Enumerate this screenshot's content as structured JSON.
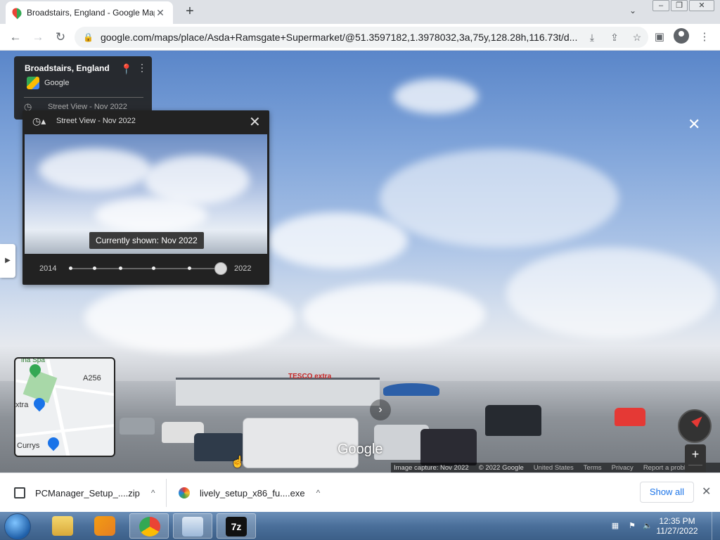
{
  "browser": {
    "tab_title": "Broadstairs, England - Google Maps",
    "tab_close": "✕",
    "new_tab": "+",
    "url": "google.com/maps/place/Asda+Ramsgate+Supermarket/@51.3597182,1.3978032,3a,75y,128.28h,116.73t/d..."
  },
  "place_card": {
    "name": "Broadstairs, England",
    "brand": "Google",
    "street_view_label": "Street View - Nov 2022"
  },
  "time_panel": {
    "header": "Street View - Nov 2022",
    "currently_shown": "Currently shown: Nov 2022",
    "year_start": "2014",
    "year_end": "2022",
    "slider_position_fraction": 1.0
  },
  "map": {
    "minimap_labels": [
      "ina Spa",
      "A256",
      "xtra",
      "Currys"
    ],
    "watermark": "Google",
    "footer": {
      "image_capture": "Image capture: Nov 2022",
      "copyright": "© 2022 Google",
      "region": "United States",
      "terms": "Terms",
      "privacy": "Privacy",
      "report": "Report a problem"
    },
    "store_sign": "TESCO extra"
  },
  "downloads": {
    "items": [
      {
        "name": "PCManager_Setup_....zip"
      },
      {
        "name": "lively_setup_x86_fu....exe"
      }
    ],
    "show_all": "Show all"
  },
  "taskbar": {
    "time": "12:35 PM",
    "date": "11/27/2022"
  },
  "colors": {
    "accent_blue": "#1a73e8",
    "map_pin_green": "#34a853",
    "map_pin_blue": "#1a73e8"
  }
}
